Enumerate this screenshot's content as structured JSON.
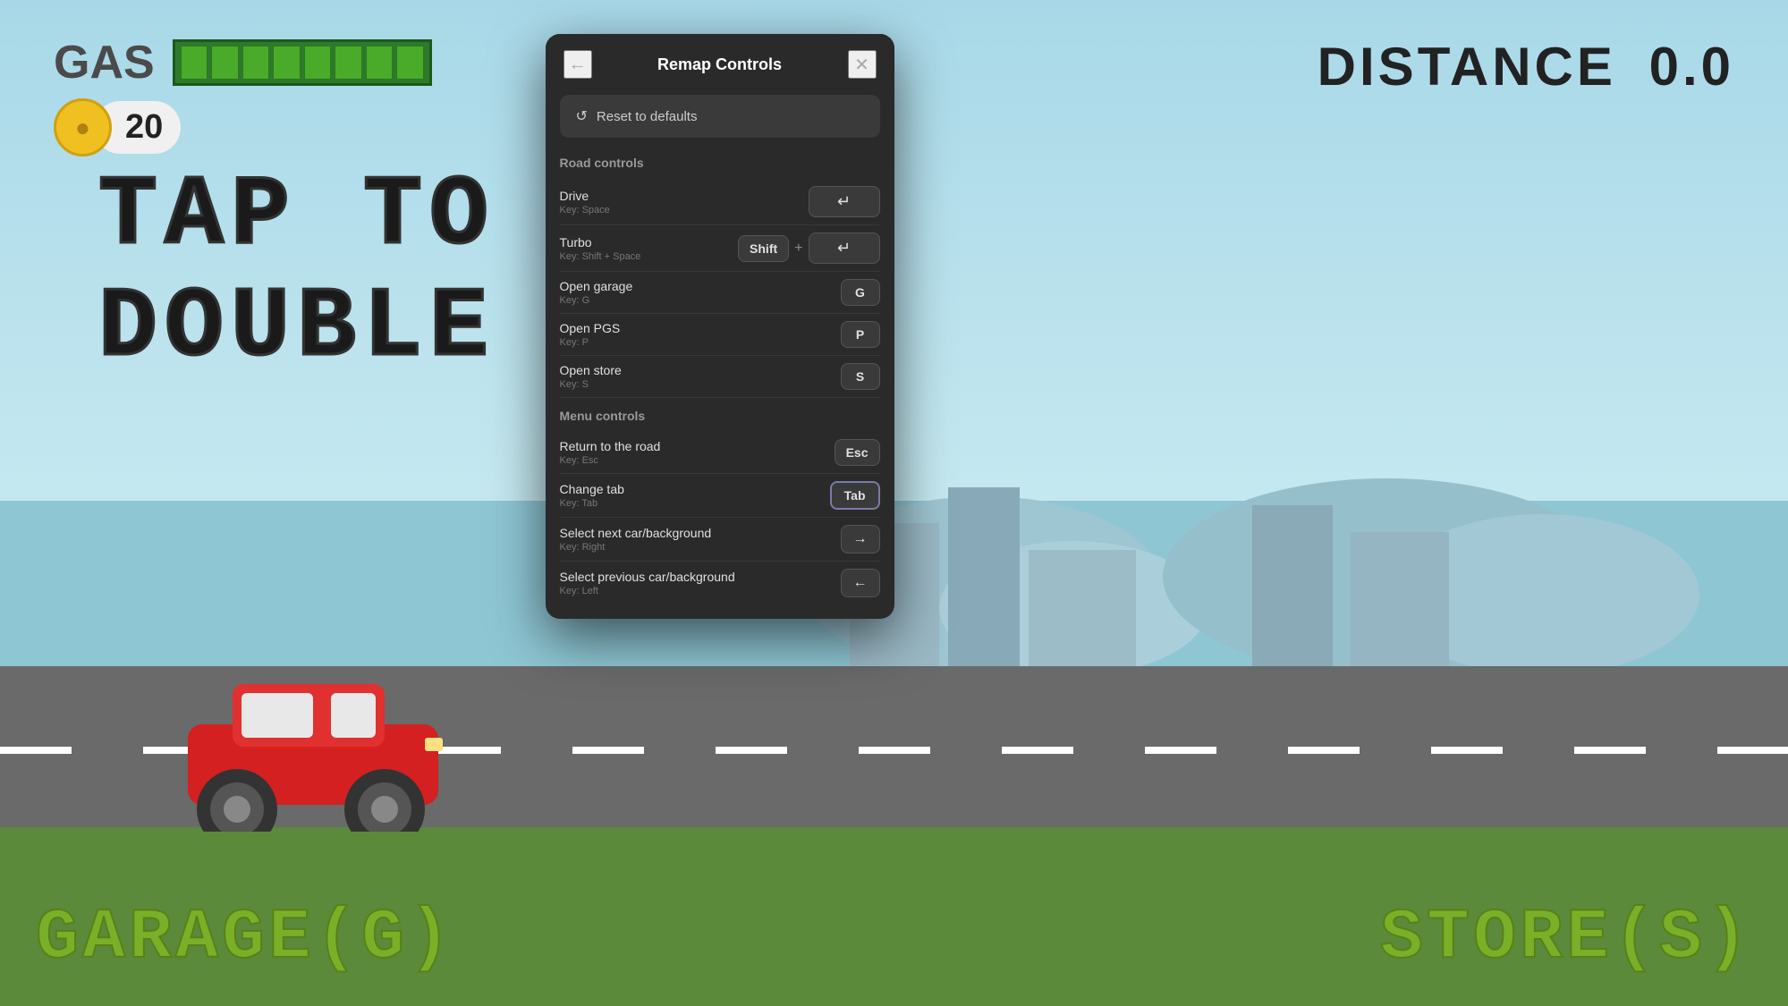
{
  "game": {
    "gas_label": "GAS",
    "distance_label": "DISTANCE",
    "distance_value": "0.0",
    "coins": "20",
    "tap_text": "TAP TO D",
    "double_text": "DOUBLE TAP",
    "garage_label": "GARAGE(G)",
    "store_label": "STORE(S)"
  },
  "modal": {
    "title": "Remap Controls",
    "back_label": "←",
    "close_label": "✕",
    "reset_label": "Reset to defaults",
    "reset_icon": "↺",
    "sections": [
      {
        "name": "Road controls",
        "controls": [
          {
            "name": "Drive",
            "key_hint": "Key: Space",
            "keys": [
              {
                "label": "↵",
                "type": "space",
                "active": false
              }
            ]
          },
          {
            "name": "Turbo",
            "key_hint": "Key: Shift + Space",
            "keys": [
              {
                "label": "Shift",
                "type": "normal",
                "active": false
              },
              {
                "label": "+",
                "type": "plus"
              },
              {
                "label": "↵",
                "type": "space",
                "active": false
              }
            ]
          },
          {
            "name": "Open garage",
            "key_hint": "Key: G",
            "keys": [
              {
                "label": "G",
                "type": "normal",
                "active": false
              }
            ]
          },
          {
            "name": "Open PGS",
            "key_hint": "Key: P",
            "keys": [
              {
                "label": "P",
                "type": "normal",
                "active": false
              }
            ]
          },
          {
            "name": "Open store",
            "key_hint": "Key: S",
            "keys": [
              {
                "label": "S",
                "type": "normal",
                "active": false
              }
            ]
          }
        ]
      },
      {
        "name": "Menu controls",
        "controls": [
          {
            "name": "Return to the road",
            "key_hint": "Key: Esc",
            "keys": [
              {
                "label": "Esc",
                "type": "normal",
                "active": false
              }
            ]
          },
          {
            "name": "Change tab",
            "key_hint": "Key: Tab",
            "keys": [
              {
                "label": "Tab",
                "type": "active",
                "active": true
              }
            ]
          },
          {
            "name": "Select next car/background",
            "key_hint": "Key: Right",
            "keys": [
              {
                "label": "→",
                "type": "normal",
                "active": false
              }
            ]
          },
          {
            "name": "Select previous car/background",
            "key_hint": "Key: Left",
            "keys": [
              {
                "label": "←",
                "type": "normal",
                "active": false
              }
            ]
          }
        ]
      }
    ]
  }
}
